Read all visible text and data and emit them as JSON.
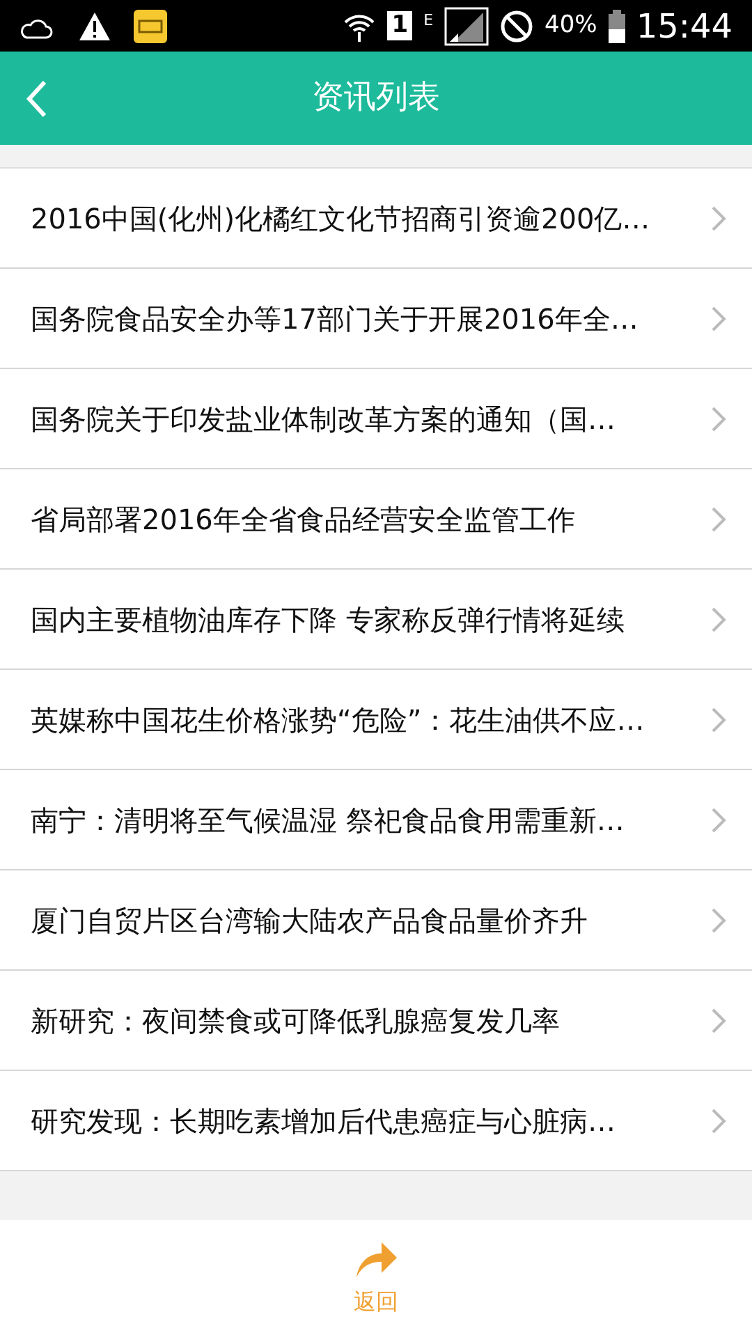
{
  "status_bar": {
    "sim_slot": "1",
    "network": "E",
    "battery": "40%",
    "time": "15:44"
  },
  "header": {
    "title": "资讯列表"
  },
  "news": [
    {
      "title": "2016中国(化州)化橘红文化节招商引资逾200亿…"
    },
    {
      "title": "国务院食品安全办等17部门关于开展2016年全…"
    },
    {
      "title": "国务院关于印发盐业体制改革方案的通知（国…"
    },
    {
      "title": "省局部署2016年全省食品经营安全监管工作"
    },
    {
      "title": "国内主要植物油库存下降 专家称反弹行情将延续"
    },
    {
      "title": "英媒称中国花生价格涨势“危险”：花生油供不应…"
    },
    {
      "title": "南宁：清明将至气候温湿 祭祀食品食用需重新…"
    },
    {
      "title": "厦门自贸片区台湾输大陆农产品食品量价齐升"
    },
    {
      "title": "新研究：夜间禁食或可降低乳腺癌复发几率"
    },
    {
      "title": "研究发现：长期吃素增加后代患癌症与心脏病…"
    }
  ],
  "footer": {
    "label": "返回"
  }
}
